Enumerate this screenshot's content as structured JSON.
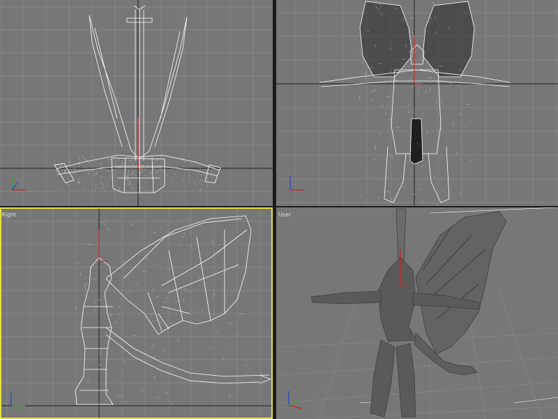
{
  "viewports": [
    {
      "id": "top",
      "label": ""
    },
    {
      "id": "front",
      "label": ""
    },
    {
      "id": "right",
      "label": "Right",
      "active": true
    },
    {
      "id": "perspective",
      "label": "User"
    }
  ],
  "colors": {
    "viewport_bg": "#777777",
    "grid": "#8c8c8c",
    "grid_major": "#1e1e1e",
    "wire": "#ffffff",
    "gizmo": "#cc2222",
    "active_border": "#e6e23a",
    "axis_x": "#cc2222",
    "axis_y": "#22aa22",
    "axis_z": "#2244cc"
  }
}
